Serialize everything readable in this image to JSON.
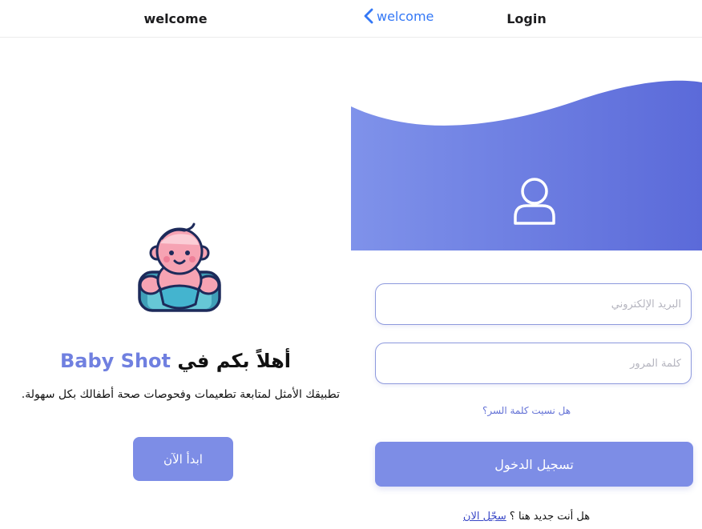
{
  "left_screen": {
    "nav_title": "welcome",
    "heading_prefix": "أهلاً بكم في",
    "heading_brand": "Baby Shot",
    "description": "تطبيقك الأمثل لمتابعة تطعيمات وفحوصات صحة أطفالك بكل سهولة.",
    "start_button": "ابدأ الآن",
    "illustration_icon": "baby-icon"
  },
  "right_screen": {
    "back_label": "welcome",
    "nav_title": "Login",
    "header_icon": "user-icon",
    "email_placeholder": "البريد الإلكتروني",
    "password_placeholder": "كلمة المرور",
    "forgot_password": "هل نسيت كلمة السر؟",
    "login_button": "تسجيل الدخول",
    "register_prompt": "هل أنت جديد هنا ؟",
    "register_link": "سجّل الان"
  },
  "colors": {
    "accent": "#7d8de6",
    "brand_text": "#7080e0",
    "wave_start": "#7f92ea",
    "wave_end": "#5b6ad9",
    "ios_blue": "#3478f6"
  }
}
